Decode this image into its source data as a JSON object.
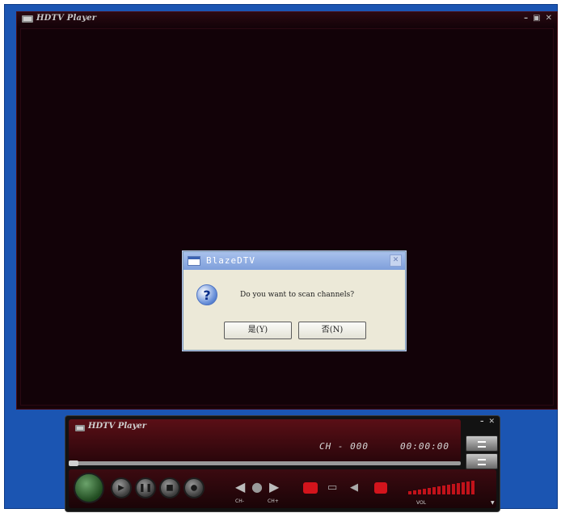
{
  "window": {
    "title": "HDTV Player",
    "controls": [
      "–",
      "▣",
      "✕"
    ]
  },
  "dialog": {
    "title": "BlazeDTV",
    "message": "Do you want to scan channels?",
    "yes_label": "是(Y)",
    "no_label": "否(N)",
    "icon": "question-icon"
  },
  "panel": {
    "title": "HDTV Player",
    "channel": "CH - 000",
    "time": "00:00:00",
    "side_controls": [
      "–",
      "✕"
    ],
    "ch_down_label": "CH-",
    "ch_up_label": "CH+",
    "vol_label": "VOL"
  },
  "colors": {
    "window_blue": "#1b55b2",
    "video_bg": "#120208",
    "panel_red": "#5a0f16",
    "record_red": "#d3141c"
  }
}
